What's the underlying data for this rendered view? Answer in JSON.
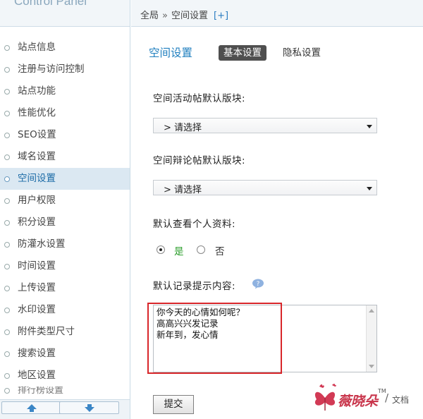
{
  "sidebar": {
    "brand": "Control Panel",
    "items": [
      {
        "label": "站点信息"
      },
      {
        "label": "注册与访问控制"
      },
      {
        "label": "站点功能"
      },
      {
        "label": "性能优化"
      },
      {
        "label": "SEO设置"
      },
      {
        "label": "域名设置"
      },
      {
        "label": "空间设置"
      },
      {
        "label": "用户权限"
      },
      {
        "label": "积分设置"
      },
      {
        "label": "防灌水设置"
      },
      {
        "label": "时间设置"
      },
      {
        "label": "上传设置"
      },
      {
        "label": "水印设置"
      },
      {
        "label": "附件类型尺寸"
      },
      {
        "label": "搜索设置"
      },
      {
        "label": "地区设置"
      },
      {
        "label": "排行榜设置"
      }
    ],
    "active_index": 6
  },
  "breadcrumb": {
    "root": "全局",
    "separator": "»",
    "current": "空间设置",
    "add_label": "[+]"
  },
  "page": {
    "title": "空间设置",
    "tabs": [
      {
        "label": "基本设置",
        "active": true
      },
      {
        "label": "隐私设置",
        "active": false
      }
    ]
  },
  "form": {
    "activity_board": {
      "label": "空间活动帖默认版块:",
      "selected": "> 请选择"
    },
    "debate_board": {
      "label": "空间辩论帖默认版块:",
      "selected": "> 请选择"
    },
    "default_profile": {
      "label": "默认查看个人资料:",
      "options": [
        {
          "label": "是",
          "checked": true
        },
        {
          "label": "否",
          "checked": false
        }
      ]
    },
    "record_hint": {
      "label": "默认记录提示内容:",
      "lines": [
        "你今天的心情如何呢？",
        "高高兴兴发记录",
        "新年到，发心情"
      ]
    },
    "submit_label": "提交"
  },
  "watermark": {
    "brand": "薇晓朵",
    "tm": "TM",
    "slash": "/",
    "sub": "文档"
  },
  "colors": {
    "accent_blue": "#1f7fbf",
    "highlight_red": "#d8262a",
    "radio_yes_green": "#2a9d2a"
  }
}
